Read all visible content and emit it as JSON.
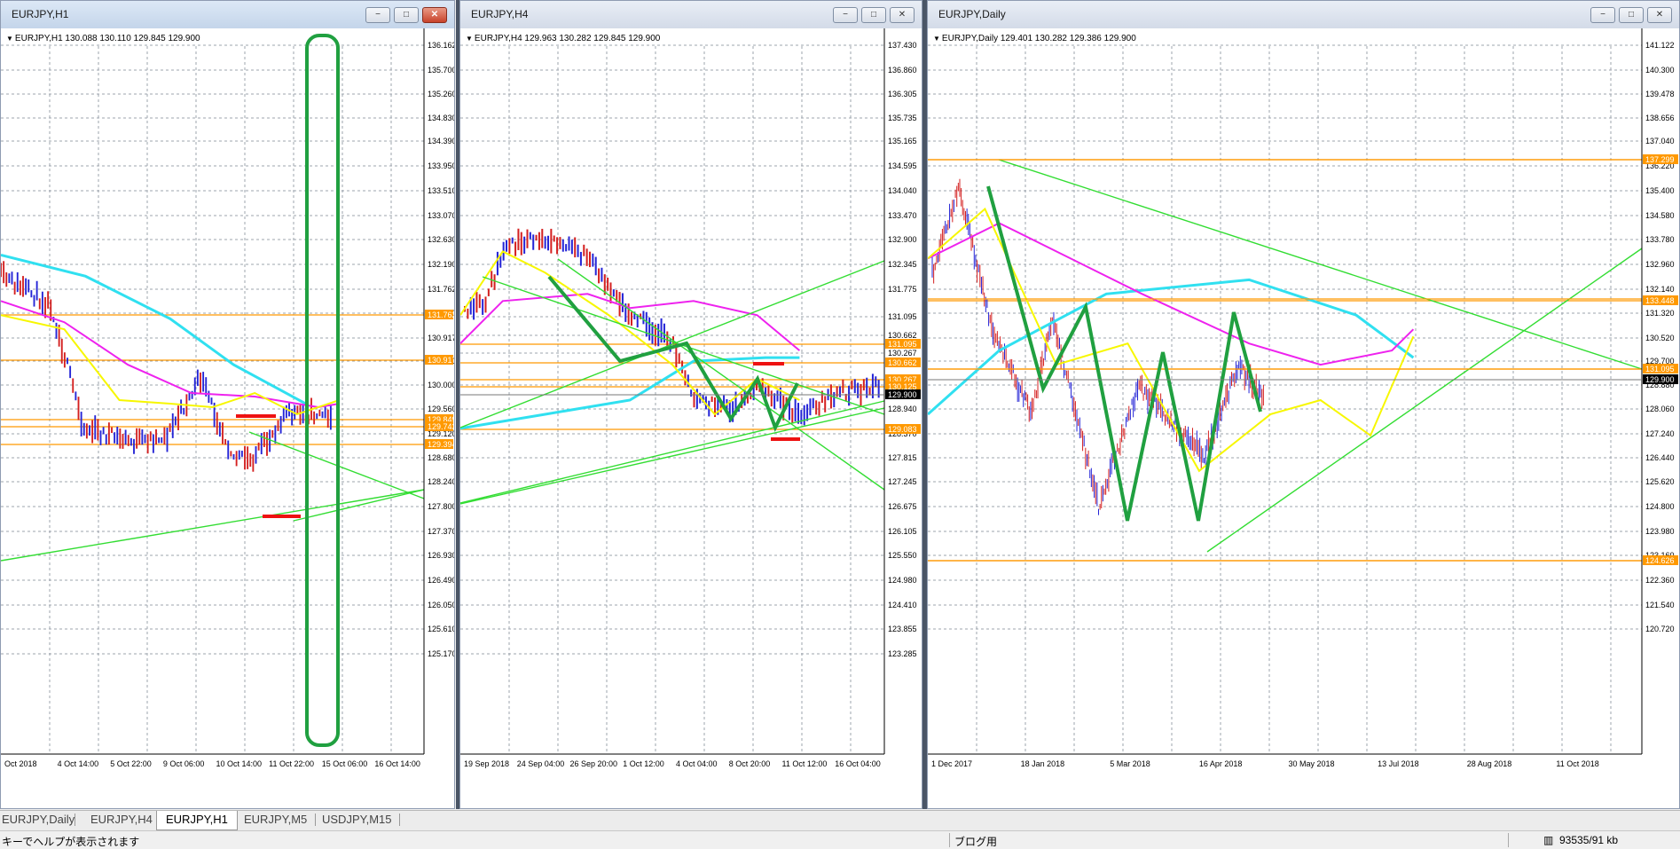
{
  "colors": {
    "chart_bg": "#ffffff",
    "grid": "#9da4ad",
    "bull": "#2424d6",
    "bear": "#d42020",
    "level": "#ff9900",
    "trend": "#33dd33",
    "zigzag": "#20a040",
    "ma_fast": "#f7f700",
    "ma_mid": "#ee22ee",
    "ma_slow": "#30e0f0",
    "marker": "#ee1111",
    "price_label_bg": "#000000"
  },
  "window_buttons": {
    "minimize": "−",
    "maximize": "□",
    "close": "✕"
  },
  "windows": [
    {
      "id": "h1",
      "title": "EURJPY,H1",
      "info_line": "EURJPY,H1  130.088 130.110 129.845 129.900",
      "current_price": "129.900",
      "y_ticks": [
        "136.162",
        "135.700",
        "135.260",
        "134.830",
        "134.390",
        "133.950",
        "133.510",
        "133.070",
        "132.630",
        "132.190",
        "131.762",
        "131.320",
        "130.917",
        "130.440",
        "130.000",
        "129.560",
        "129.120",
        "128.680",
        "128.240",
        "127.800",
        "127.370",
        "126.930",
        "126.490",
        "126.050",
        "125.610",
        "125.170"
      ],
      "level_labels": [
        {
          "text": "131.762",
          "price": 131.76
        },
        {
          "text": "130.917",
          "price": 130.92
        },
        {
          "text": "129.849",
          "price": 129.85
        },
        {
          "text": "129.743",
          "price": 129.74
        },
        {
          "text": "129.394",
          "price": 129.39
        }
      ],
      "x_labels": [
        "Oct 2018",
        "4 Oct 14:00",
        "5 Oct 22:00",
        "9 Oct 06:00",
        "10 Oct 14:00",
        "11 Oct 22:00",
        "15 Oct 06:00",
        "16 Oct 14:00"
      ]
    },
    {
      "id": "h4",
      "title": "EURJPY,H4",
      "info_line": "EURJPY,H4  129.963 130.282 129.845 129.900",
      "current_price": "129.900",
      "y_ticks": [
        "137.430",
        "136.860",
        "136.305",
        "135.735",
        "135.165",
        "134.595",
        "134.040",
        "133.470",
        "132.900",
        "132.345",
        "131.775",
        "131.095",
        "130.662",
        "130.267",
        "129.510",
        "128.940",
        "128.370",
        "127.815",
        "127.245",
        "126.675",
        "126.105",
        "125.550",
        "124.980",
        "124.410",
        "123.855",
        "123.285"
      ],
      "level_labels": [
        {
          "text": "131.095",
          "price": 131.1
        },
        {
          "text": "130.662",
          "price": 130.66
        },
        {
          "text": "130.267",
          "price": 130.27
        },
        {
          "text": "130.125",
          "price": 130.13
        },
        {
          "text": "129.083",
          "price": 129.08
        }
      ],
      "x_labels": [
        "19 Sep 2018",
        "24 Sep 04:00",
        "26 Sep 20:00",
        "1 Oct 12:00",
        "4 Oct 04:00",
        "8 Oct 20:00",
        "11 Oct 12:00",
        "16 Oct 04:00"
      ]
    },
    {
      "id": "d1",
      "title": "EURJPY,Daily",
      "info_line": "EURJPY,Daily  129.401 130.282 129.386 129.900",
      "current_price": "129.900",
      "y_ticks": [
        "141.122",
        "140.300",
        "139.478",
        "138.656",
        "137.040",
        "136.220",
        "135.400",
        "134.580",
        "133.780",
        "132.960",
        "132.140",
        "131.320",
        "130.520",
        "129.700",
        "128.880",
        "128.060",
        "127.240",
        "126.440",
        "125.620",
        "124.800",
        "123.980",
        "123.160",
        "122.360",
        "121.540",
        "120.720"
      ],
      "level_labels": [
        {
          "text": "137.299",
          "price": 137.3
        },
        {
          "text": "133.448",
          "price": 133.45
        },
        {
          "text": "131.095",
          "price": 131.1
        },
        {
          "text": "124.626",
          "price": 124.63
        }
      ],
      "x_labels": [
        "1 Dec 2017",
        "18 Jan 2018",
        "5 Mar 2018",
        "16 Apr 2018",
        "30 May 2018",
        "13 Jul 2018",
        "28 Aug 2018",
        "11 Oct 2018"
      ]
    }
  ],
  "tabs": [
    "EURJPY,Daily",
    "EURJPY,H4",
    "EURJPY,H1",
    "EURJPY,M5",
    "USDJPY,M15"
  ],
  "active_tab": "EURJPY,H1",
  "status": {
    "help": "キーでヘルプが表示されます",
    "profile": "ブログ用",
    "traffic": "93535/91 kb"
  }
}
